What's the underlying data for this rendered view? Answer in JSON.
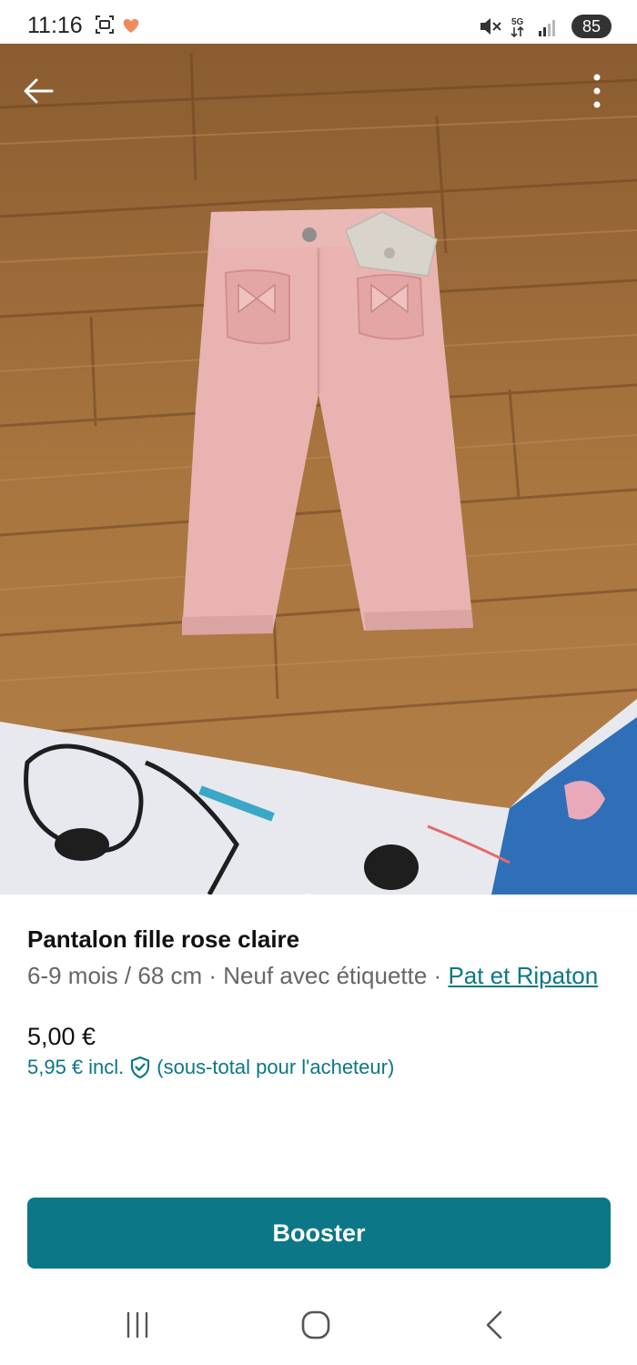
{
  "status_bar": {
    "time": "11:16",
    "network": "5G",
    "battery": "85"
  },
  "listing": {
    "title": "Pantalon fille rose claire",
    "size": "6-9 mois / 68 cm",
    "separator": " · ",
    "condition": "Neuf avec étiquette",
    "brand": "Pat et Ripaton",
    "price": "5,00 €",
    "price_incl": "5,95 €",
    "incl_label": "incl.",
    "incl_note": "(sous-total pour l'acheteur)"
  },
  "carousel": {
    "count": 4,
    "active_index": 1
  },
  "actions": {
    "booster_label": "Booster"
  },
  "icons": {
    "back": "arrow-left-icon",
    "more": "more-vertical-icon",
    "shield": "shield-check-icon"
  },
  "colors": {
    "accent": "#0b7787",
    "pants": "#e9b3b1",
    "floor": "#9a6a3c"
  }
}
